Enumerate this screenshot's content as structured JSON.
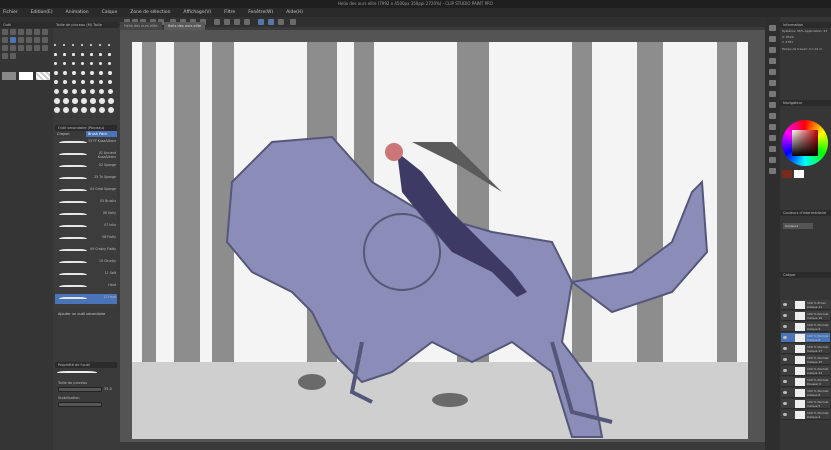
{
  "window": {
    "title": "Helix des ours elite (7992 x 4500px 350ppi 2720%) - CLIP STUDIO PAINT PRO"
  },
  "menu": [
    "Fichier",
    "Edition(E)",
    "Animation",
    "Calque",
    "Zone de sélection",
    "Affichage(V)",
    "Filtre",
    "Fenêtre(W)",
    "Aide(H)"
  ],
  "tabs": [
    {
      "label": "Helix des ours elite",
      "active": false
    },
    {
      "label": "Helix des ours elite",
      "active": true
    }
  ],
  "tool_panel": {
    "header": "Outil"
  },
  "brush_panel": {
    "header": "Taille de pinceau (M) Taille"
  },
  "subtool_panel": {
    "header": "Outil secondaire (Pinceau)",
    "tabs": [
      "Crayon",
      "Brush Pack"
    ],
    "items": [
      {
        "label": "33 FF Kusa&Ikaru",
        "active": false
      },
      {
        "label": "01 Ancient Kusa&Ikaru",
        "active": false
      },
      {
        "label": "02 Sponge",
        "active": false
      },
      {
        "label": "25 Tri Sponge",
        "active": false
      },
      {
        "label": "04 Grab Sponge",
        "active": false
      },
      {
        "label": "05 Brushs",
        "active": false
      },
      {
        "label": "06 Gelly",
        "active": false
      },
      {
        "label": "07 Inku",
        "active": false
      },
      {
        "label": "08 Flatly",
        "active": false
      },
      {
        "label": "09 Crosky Flatty",
        "active": false
      },
      {
        "label": "10 Chunky",
        "active": false
      },
      {
        "label": "11 Soft",
        "active": false
      },
      {
        "label": "Hard",
        "active": false
      },
      {
        "label": "12 Hard",
        "active": true
      }
    ],
    "add_label": "Ajouter un outil secondaire"
  },
  "tool_props": {
    "header": "Propriété de l'outil",
    "brush_size_label": "Taille de pinceau",
    "brush_size_value": "35.0",
    "stabilization_label": "Stabilisation"
  },
  "info_panel": {
    "header": "Information",
    "lines": [
      "Système: 95% Application: 23",
      "X: 6529",
      "Y: 2781",
      "Temps de travail: 4 h 10 m"
    ]
  },
  "navigator": {
    "header": "Navigateur"
  },
  "color_panel": {
    "primary": "#7a2a1a",
    "secondary": "#ffffff"
  },
  "color_set": {
    "header": "Couleurs d'intermédiaire",
    "value": "Couleurs"
  },
  "layers": {
    "header": "Calque",
    "items": [
      {
        "label": "100 % Écran Calque 11"
      },
      {
        "label": "100 % Normal Calque 10"
      },
      {
        "label": "100 % Normal Calque 9"
      },
      {
        "label": "100 % Normal Calque 8"
      },
      {
        "label": "100 % Normal Calque 17"
      },
      {
        "label": "100 % Normal Calque 15"
      },
      {
        "label": "100 % Normal Calque 14"
      },
      {
        "label": "100 % Normal Dossier 2"
      },
      {
        "label": "100 % Normal Calque 6"
      },
      {
        "label": "100 % Normal Calque 5"
      },
      {
        "label": "100 % Normal Calque 4"
      }
    ]
  }
}
